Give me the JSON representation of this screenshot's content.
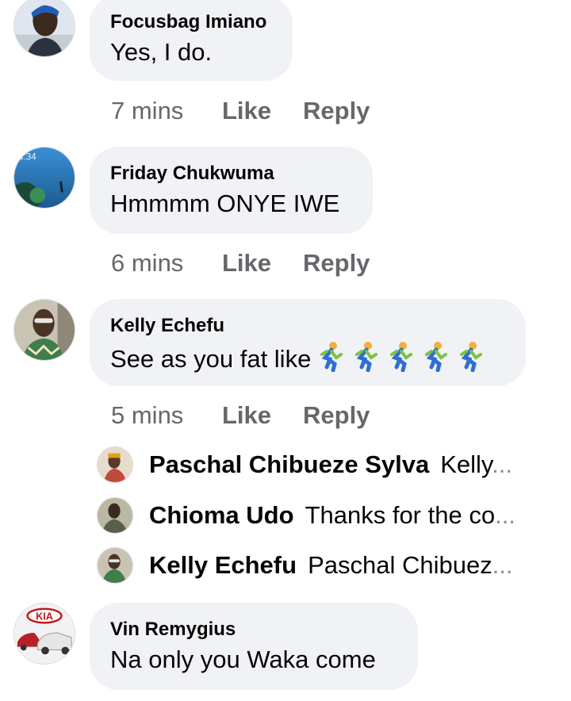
{
  "comments": [
    {
      "author": "Focusbag Imiano",
      "text": "Yes, I do.",
      "time": "7 mins",
      "like": "Like",
      "reply": "Reply"
    },
    {
      "author": "Friday Chukwuma",
      "text": "Hmmmm ONYE IWE",
      "time": "6 mins",
      "like": "Like",
      "reply": "Reply",
      "avatar_clock": "3:34"
    },
    {
      "author": "Kelly Echefu",
      "text": "See as you fat like",
      "emoji": [
        "person-running-icon",
        "person-running-icon",
        "person-running-icon",
        "person-running-icon",
        "person-running-icon"
      ],
      "time": "5 mins",
      "like": "Like",
      "reply": "Reply"
    },
    {
      "author": "Vin Remygius",
      "text": "Na only you Waka come",
      "avatar_logo": "KIA"
    }
  ],
  "replies": [
    {
      "author": "Paschal Chibueze Sylva",
      "preview": "Kelly",
      "ellipsis": "..."
    },
    {
      "author": "Chioma Udo",
      "preview": "Thanks for the co",
      "ellipsis": "..."
    },
    {
      "author": "Kelly Echefu",
      "preview": "Paschal Chibuez",
      "ellipsis": "..."
    }
  ],
  "colors": {
    "bubble": "#f0f2f5",
    "meta": "#65676b",
    "text": "#050505"
  }
}
